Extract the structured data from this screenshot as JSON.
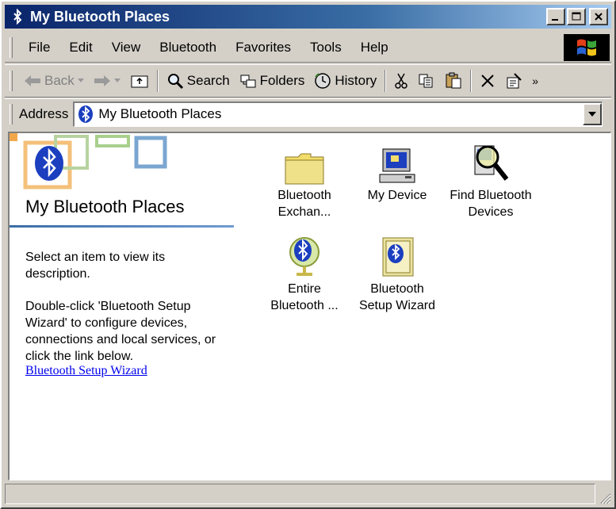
{
  "window": {
    "title": "My Bluetooth Places",
    "minimize_label": "_",
    "maximize_label": "□",
    "close_label": "✕"
  },
  "menubar": {
    "items": [
      "File",
      "Edit",
      "View",
      "Bluetooth",
      "Favorites",
      "Tools",
      "Help"
    ]
  },
  "toolbar": {
    "back_label": "Back",
    "search_label": "Search",
    "folders_label": "Folders",
    "history_label": "History",
    "overflow_label": "»"
  },
  "address": {
    "label": "Address",
    "value": "My Bluetooth Places"
  },
  "leftpane": {
    "title": "My Bluetooth Places",
    "description1": "Select an item to view its description.",
    "description2": "Double-click 'Bluetooth Setup Wizard' to configure devices, connections and local services, or click the link below.",
    "link_text": "Bluetooth Setup Wizard"
  },
  "items": [
    {
      "name": "bluetooth-exchange-folder",
      "line1": "Bluetooth",
      "line2": "Exchan...",
      "icon": "folder-icon"
    },
    {
      "name": "my-device",
      "line1": "My Device",
      "line2": "",
      "icon": "computer-icon"
    },
    {
      "name": "find-bluetooth-devices",
      "line1": "Find Bluetooth",
      "line2": "Devices",
      "icon": "magnifier-icon"
    },
    {
      "name": "entire-bluetooth-neighborhood",
      "line1": "Entire",
      "line2": "Bluetooth ...",
      "icon": "globe-icon"
    },
    {
      "name": "bluetooth-setup-wizard",
      "line1": "Bluetooth",
      "line2": "Setup Wizard",
      "icon": "wizard-icon"
    }
  ],
  "colors": {
    "titlebar": "#0a246a",
    "bluetooth_blue": "#1b3fbf",
    "link": "#0000ee"
  }
}
